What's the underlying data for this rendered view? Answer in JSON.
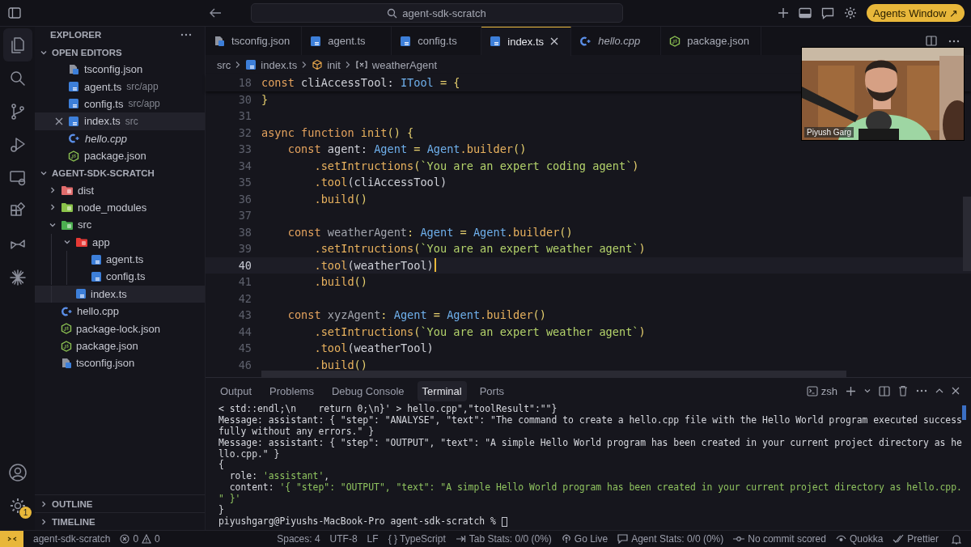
{
  "titlebar": {
    "search": "agent-sdk-scratch",
    "agents_button": "Agents Window ↗"
  },
  "explorer": {
    "title": "EXPLORER",
    "open_editors": {
      "title": "OPEN EDITORS",
      "expanded": true,
      "items": [
        {
          "name": "tsconfig.json",
          "kind": "tsconfig",
          "selected": false,
          "preview": false
        },
        {
          "name": "agent.ts",
          "path": "src/app",
          "kind": "ts",
          "selected": false,
          "preview": false
        },
        {
          "name": "config.ts",
          "path": "src/app",
          "kind": "ts",
          "selected": false,
          "preview": false
        },
        {
          "name": "index.ts",
          "path": "src",
          "kind": "ts",
          "selected": true,
          "preview": false
        },
        {
          "name": "hello.cpp",
          "kind": "cpp",
          "selected": false,
          "preview": true
        },
        {
          "name": "package.json",
          "kind": "json",
          "selected": false,
          "preview": false
        }
      ]
    },
    "project": {
      "title": "AGENT-SDK-SCRATCH",
      "expanded": true,
      "tree": [
        {
          "name": "dist",
          "kind": "folder",
          "color": "#e06c6c",
          "expanded": false,
          "selected": false
        },
        {
          "name": "node_modules",
          "kind": "folder",
          "color": "#8bc34a",
          "expanded": false,
          "selected": false
        },
        {
          "name": "src",
          "kind": "folder",
          "color": "#4caf50",
          "expanded": true,
          "selected": false,
          "children": [
            {
              "name": "app",
              "kind": "folder",
              "color": "#e53935",
              "expanded": true,
              "selected": false,
              "children": [
                {
                  "name": "agent.ts",
                  "kind": "ts",
                  "selected": false
                },
                {
                  "name": "config.ts",
                  "kind": "ts",
                  "selected": false
                }
              ]
            },
            {
              "name": "index.ts",
              "kind": "ts",
              "selected": true
            }
          ]
        },
        {
          "name": "hello.cpp",
          "kind": "cpp",
          "selected": false
        },
        {
          "name": "package-lock.json",
          "kind": "json",
          "selected": false
        },
        {
          "name": "package.json",
          "kind": "json",
          "selected": false
        },
        {
          "name": "tsconfig.json",
          "kind": "tsconfig",
          "selected": false
        }
      ]
    },
    "sections": [
      {
        "title": "OUTLINE",
        "expanded": false
      },
      {
        "title": "TIMELINE",
        "expanded": false
      }
    ]
  },
  "settings_badge": "1",
  "tabs": [
    {
      "name": "tsconfig.json",
      "kind": "tsconfig",
      "selected": false,
      "preview": false
    },
    {
      "name": "agent.ts",
      "kind": "ts",
      "selected": false,
      "preview": false
    },
    {
      "name": "config.ts",
      "kind": "ts",
      "selected": false,
      "preview": false
    },
    {
      "name": "index.ts",
      "kind": "ts",
      "selected": true,
      "preview": false
    },
    {
      "name": "hello.cpp",
      "kind": "cpp",
      "selected": false,
      "preview": true
    },
    {
      "name": "package.json",
      "kind": "json",
      "selected": false,
      "preview": false
    }
  ],
  "breadcrumb": [
    {
      "text": "src",
      "kind": "folder"
    },
    {
      "text": "index.ts",
      "kind": "ts"
    },
    {
      "text": "init",
      "kind": "function"
    },
    {
      "text": "weatherAgent",
      "kind": "variable"
    }
  ],
  "code": [
    {
      "number": "18",
      "current": false,
      "tokens": [
        {
          "text": "const ",
          "kind": "kw"
        },
        {
          "text": "cliAccessTool: ",
          "kind": "var"
        },
        {
          "text": "ITool",
          "kind": "type"
        },
        {
          "text": " = {",
          "kind": "punc"
        }
      ]
    },
    {
      "number": "30",
      "current": false,
      "tokens": [
        {
          "text": "}",
          "kind": "punc"
        }
      ]
    },
    {
      "number": "31",
      "current": false
    },
    {
      "number": "32",
      "current": false,
      "tokens": [
        {
          "text": "async function ",
          "kind": "kw"
        },
        {
          "text": "init",
          "kind": "fn"
        },
        {
          "text": "() {",
          "kind": "punc"
        }
      ]
    },
    {
      "number": "33",
      "current": false,
      "tokens": [
        {
          "text": "    const ",
          "kind": "kw"
        },
        {
          "text": "agent: ",
          "kind": "var"
        },
        {
          "text": "Agent",
          "kind": "type"
        },
        {
          "text": " = ",
          "kind": "punc"
        },
        {
          "text": "Agent",
          "kind": "type"
        },
        {
          "text": ".builder",
          "kind": "fn"
        },
        {
          "text": "()",
          "kind": "punc"
        }
      ]
    },
    {
      "number": "34",
      "current": false,
      "tokens": [
        {
          "text": "        .setIntructions",
          "kind": "fn"
        },
        {
          "text": "(",
          "kind": "punc"
        },
        {
          "text": "`You are an expert coding agent`",
          "kind": "str"
        },
        {
          "text": ")",
          "kind": "punc"
        }
      ]
    },
    {
      "number": "35",
      "current": false,
      "tokens": [
        {
          "text": "        .tool",
          "kind": "fn"
        },
        {
          "text": "(cliAccessTool)",
          "kind": "var"
        }
      ]
    },
    {
      "number": "36",
      "current": false,
      "tokens": [
        {
          "text": "        .build",
          "kind": "fn"
        },
        {
          "text": "()",
          "kind": "punc"
        }
      ]
    },
    {
      "number": "37",
      "current": false
    },
    {
      "number": "38",
      "current": false,
      "tokens": [
        {
          "text": "    const ",
          "kind": "kw"
        },
        {
          "text": "weatherAgent",
          "kind": "dim"
        },
        {
          "text": ": ",
          "kind": "punc"
        },
        {
          "text": "Agent",
          "kind": "type"
        },
        {
          "text": " = ",
          "kind": "punc"
        },
        {
          "text": "Agent",
          "kind": "type"
        },
        {
          "text": ".builder",
          "kind": "fn"
        },
        {
          "text": "()",
          "kind": "punc"
        }
      ]
    },
    {
      "number": "39",
      "current": false,
      "tokens": [
        {
          "text": "        .setIntructions",
          "kind": "fn"
        },
        {
          "text": "(",
          "kind": "punc"
        },
        {
          "text": "`You are an expert weather agent`",
          "kind": "str"
        },
        {
          "text": ")",
          "kind": "punc"
        }
      ]
    },
    {
      "number": "40",
      "current": true,
      "tokens": [
        {
          "text": "        .tool",
          "kind": "fn"
        },
        {
          "text": "(weatherTool)",
          "kind": "var"
        }
      ]
    },
    {
      "number": "41",
      "current": false,
      "tokens": [
        {
          "text": "        .build",
          "kind": "fn"
        },
        {
          "text": "()",
          "kind": "punc"
        }
      ]
    },
    {
      "number": "42",
      "current": false
    },
    {
      "number": "43",
      "current": false,
      "tokens": [
        {
          "text": "    const ",
          "kind": "kw"
        },
        {
          "text": "xyzAgent",
          "kind": "dim"
        },
        {
          "text": ": ",
          "kind": "punc"
        },
        {
          "text": "Agent",
          "kind": "type"
        },
        {
          "text": " = ",
          "kind": "punc"
        },
        {
          "text": "Agent",
          "kind": "type"
        },
        {
          "text": ".builder",
          "kind": "fn"
        },
        {
          "text": "()",
          "kind": "punc"
        }
      ]
    },
    {
      "number": "44",
      "current": false,
      "tokens": [
        {
          "text": "        .setIntructions",
          "kind": "fn"
        },
        {
          "text": "(",
          "kind": "punc"
        },
        {
          "text": "`You are an expert weather agent`",
          "kind": "str"
        },
        {
          "text": ")",
          "kind": "punc"
        }
      ]
    },
    {
      "number": "45",
      "current": false,
      "tokens": [
        {
          "text": "        .tool",
          "kind": "fn"
        },
        {
          "text": "(weatherTool)",
          "kind": "var"
        }
      ]
    },
    {
      "number": "46",
      "current": false,
      "tokens": [
        {
          "text": "        .build",
          "kind": "fn"
        },
        {
          "text": "()",
          "kind": "punc"
        }
      ]
    }
  ],
  "webcam": {
    "kind": "picture",
    "caption": "Piyush Garg"
  },
  "panel": {
    "tabs": [
      {
        "label": "Output",
        "selected": false
      },
      {
        "label": "Problems",
        "selected": false
      },
      {
        "label": "Debug Console",
        "selected": false
      },
      {
        "label": "Terminal",
        "selected": true
      },
      {
        "label": "Ports",
        "selected": false
      }
    ],
    "shell": "zsh",
    "terminal": [
      [
        {
          "text": "< std::endl;\\n    return 0;\\n}' > hello.cpp\",\"toolResult\":\"\"}",
          "kind": "out"
        }
      ],
      [
        {
          "text": "Message: assistant: { \"step\": \"ANALYSE\", \"text\": \"The command to create a hello.cpp file with the Hello World program executed success",
          "kind": "out"
        }
      ],
      [
        {
          "text": "fully without any errors.\" }",
          "kind": "out"
        }
      ],
      [
        {
          "text": "Message: assistant: { \"step\": \"OUTPUT\", \"text\": \"A simple Hello World program has been created in your current project directory as he",
          "kind": "out"
        }
      ],
      [
        {
          "text": "llo.cpp.\" }",
          "kind": "out"
        }
      ],
      [
        {
          "text": "{",
          "kind": "out"
        }
      ],
      [
        {
          "text": "  role: ",
          "kind": "out"
        },
        {
          "text": "'assistant'",
          "kind": "str"
        },
        {
          "text": ",",
          "kind": "out"
        }
      ],
      [
        {
          "text": "  content: ",
          "kind": "out"
        },
        {
          "text": "'{ \"step\": \"OUTPUT\", \"text\": \"A simple Hello World program has been created in your current project directory as hello.cpp.",
          "kind": "str"
        }
      ],
      [
        {
          "text": "\" }'",
          "kind": "str"
        }
      ],
      [
        {
          "text": "}",
          "kind": "out"
        }
      ]
    ],
    "prompt": "piyushgarg@Piyushs-MacBook-Pro agent-sdk-scratch % "
  },
  "status_bar": {
    "folder": "agent-sdk-scratch",
    "errors": "0",
    "warnings": "0",
    "items": [
      {
        "text": "Spaces: 4",
        "kind": "plain"
      },
      {
        "text": "UTF-8",
        "kind": "plain"
      },
      {
        "text": "LF",
        "kind": "plain"
      },
      {
        "text": "{ } TypeScript",
        "kind": "plain"
      },
      {
        "text": "Tab Stats: 0/0 (0%)",
        "kind": "tab"
      },
      {
        "text": "Go Live",
        "kind": "broadcast"
      },
      {
        "text": "Agent Stats: 0/0 (0%)",
        "kind": "chat"
      },
      {
        "text": "No commit scored",
        "kind": "commit"
      },
      {
        "text": "Quokka",
        "kind": "eye"
      },
      {
        "text": "Prettier",
        "kind": "check"
      }
    ]
  }
}
